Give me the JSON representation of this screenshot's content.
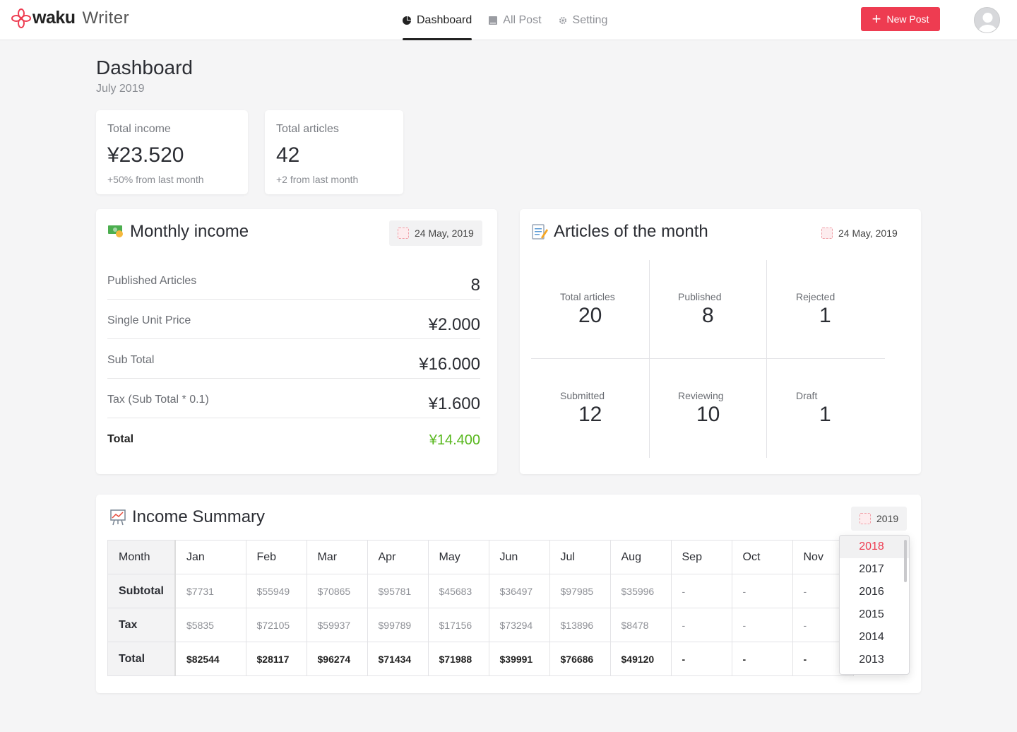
{
  "brand": {
    "name": "waku",
    "sub": "Writer"
  },
  "nav": [
    {
      "label": "Dashboard",
      "icon": "pie-chart-icon",
      "active": true
    },
    {
      "label": "All Post",
      "icon": "document-icon",
      "active": false
    },
    {
      "label": "Setting",
      "icon": "gear-icon",
      "active": false
    }
  ],
  "new_post_label": "New Post",
  "page": {
    "title": "Dashboard",
    "subtitle": "July 2019"
  },
  "stats": [
    {
      "label": "Total income",
      "value": "¥23.520",
      "foot": "+50% from last month"
    },
    {
      "label": "Total articles",
      "value": "42",
      "foot": "+2 from last month"
    }
  ],
  "monthly_income": {
    "title": "Monthly income",
    "date": "24 May, 2019",
    "rows": [
      {
        "label": "Published Articles",
        "value": "8"
      },
      {
        "label": "Single Unit Price",
        "value": "¥2.000"
      },
      {
        "label": "Sub Total",
        "value": "¥16.000"
      },
      {
        "label": "Tax (Sub Total * 0.1)",
        "value": "¥1.600"
      },
      {
        "label": "Total",
        "value": "¥14.400"
      }
    ]
  },
  "articles": {
    "title": "Articles of the month",
    "date": "24 May, 2019",
    "cells": [
      {
        "label": "Total articles",
        "value": "20"
      },
      {
        "label": "Published",
        "value": "8"
      },
      {
        "label": "Rejected",
        "value": "1"
      },
      {
        "label": "Submitted",
        "value": "12"
      },
      {
        "label": "Reviewing",
        "value": "10"
      },
      {
        "label": "Draft",
        "value": "1"
      }
    ]
  },
  "income_summary": {
    "title": "Income Summary",
    "year": "2019",
    "columns": [
      "Month",
      "Jan",
      "Feb",
      "Mar",
      "Apr",
      "May",
      "Jun",
      "Jul",
      "Aug",
      "Sep",
      "Oct",
      "Nov"
    ],
    "rows": [
      {
        "label": "Subtotal",
        "values": [
          "$7731",
          "$55949",
          "$70865",
          "$95781",
          "$45683",
          "$36497",
          "$97985",
          "$35996",
          "-",
          "-",
          "-"
        ]
      },
      {
        "label": "Tax",
        "values": [
          "$5835",
          "$72105",
          "$59937",
          "$99789",
          "$17156",
          "$73294",
          "$13896",
          "$8478",
          "-",
          "-",
          "-"
        ]
      },
      {
        "label": "Total",
        "values": [
          "$82544",
          "$28117",
          "$96274",
          "$71434",
          "$71988",
          "$39991",
          "$76686",
          "$49120",
          "-",
          "-",
          "-"
        ]
      }
    ],
    "year_options": [
      "2018",
      "2017",
      "2016",
      "2015",
      "2014",
      "2013"
    ],
    "highlighted_year": "2018"
  },
  "colors": {
    "accent": "#ee3c51",
    "positive": "#57b71c"
  }
}
